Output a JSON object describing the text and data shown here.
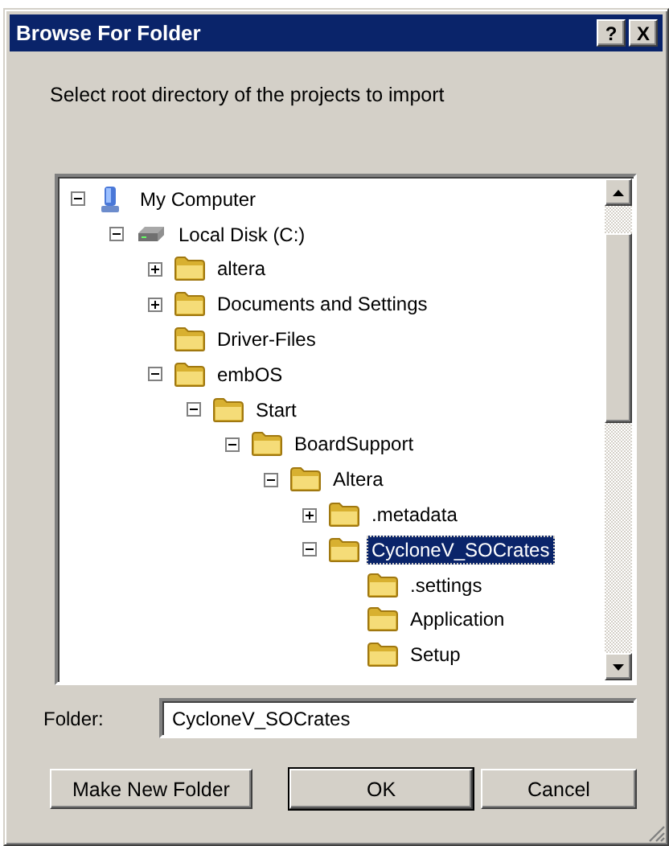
{
  "window": {
    "title": "Browse For Folder",
    "title_buttons": [
      {
        "kind": "help",
        "label": "?"
      },
      {
        "kind": "close",
        "label": "X"
      }
    ]
  },
  "instruction": "Select root directory of the projects to import",
  "tree": {
    "items": [
      {
        "label": "My Computer",
        "kind": "computer",
        "expander": true,
        "expanded": true,
        "selected": false,
        "children": [
          {
            "label": "Local Disk (C:)",
            "kind": "drive",
            "expander": true,
            "expanded": true,
            "selected": false,
            "children": [
              {
                "label": "altera",
                "kind": "folder",
                "expander": true,
                "expanded": false,
                "selected": false
              },
              {
                "label": "Documents and Settings",
                "kind": "folder",
                "expander": true,
                "expanded": false,
                "selected": false
              },
              {
                "label": "Driver-Files",
                "kind": "folder",
                "expander": false,
                "selected": false
              },
              {
                "label": "embOS",
                "kind": "folder",
                "expander": true,
                "expanded": true,
                "selected": false,
                "children": [
                  {
                    "label": "Start",
                    "kind": "folder",
                    "expander": true,
                    "expanded": true,
                    "selected": false,
                    "children": [
                      {
                        "label": "BoardSupport",
                        "kind": "folder",
                        "expander": true,
                        "expanded": true,
                        "selected": false,
                        "children": [
                          {
                            "label": "Altera",
                            "kind": "folder",
                            "expander": true,
                            "expanded": true,
                            "selected": false,
                            "children": [
                              {
                                "label": ".metadata",
                                "kind": "folder",
                                "expander": true,
                                "expanded": false,
                                "selected": false
                              },
                              {
                                "label": "CycloneV_SOCrates",
                                "kind": "folder",
                                "expander": true,
                                "expanded": true,
                                "selected": true,
                                "children": [
                                  {
                                    "label": ".settings",
                                    "kind": "folder",
                                    "expander": false,
                                    "selected": false
                                  },
                                  {
                                    "label": "Application",
                                    "kind": "folder",
                                    "expander": false,
                                    "selected": false
                                  },
                                  {
                                    "label": "Setup",
                                    "kind": "folder",
                                    "expander": false,
                                    "selected": false
                                  }
                                ]
                              }
                            ]
                          }
                        ]
                      }
                    ]
                  }
                ]
              }
            ]
          }
        ]
      }
    ]
  },
  "folder": {
    "label": "Folder:",
    "value": "CycloneV_SOCrates"
  },
  "buttons": [
    {
      "label": "Make New Folder",
      "default": false
    },
    {
      "label": "OK",
      "default": true
    },
    {
      "label": "Cancel",
      "default": false
    }
  ]
}
